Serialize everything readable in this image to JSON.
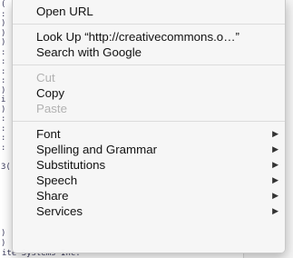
{
  "background": {
    "left_code_lines": [
      "(",
      ":",
      ")",
      ")",
      ")",
      ":",
      ":",
      ":",
      ":",
      ")",
      "i",
      ")",
      ":",
      ":",
      ":",
      ":",
      "",
      "3(",
      "",
      "",
      "",
      "",
      "",
      "",
      ")",
      ")"
    ],
    "bottom_line": "ite Systems Inc.  "
  },
  "menu": {
    "groups": [
      [
        {
          "label": "Open URL",
          "enabled": true,
          "submenu": false
        }
      ],
      [
        {
          "label": "Look Up “http://creativecommons.o…”",
          "enabled": true,
          "submenu": false
        },
        {
          "label": "Search with Google",
          "enabled": true,
          "submenu": false
        }
      ],
      [
        {
          "label": "Cut",
          "enabled": false,
          "submenu": false
        },
        {
          "label": "Copy",
          "enabled": true,
          "submenu": false
        },
        {
          "label": "Paste",
          "enabled": false,
          "submenu": false
        }
      ],
      [
        {
          "label": "Font",
          "enabled": true,
          "submenu": true
        },
        {
          "label": "Spelling and Grammar",
          "enabled": true,
          "submenu": true
        },
        {
          "label": "Substitutions",
          "enabled": true,
          "submenu": true
        },
        {
          "label": "Speech",
          "enabled": true,
          "submenu": true
        },
        {
          "label": "Share",
          "enabled": true,
          "submenu": true
        },
        {
          "label": "Services",
          "enabled": true,
          "submenu": true
        }
      ]
    ],
    "submenu_arrow": "▶"
  }
}
